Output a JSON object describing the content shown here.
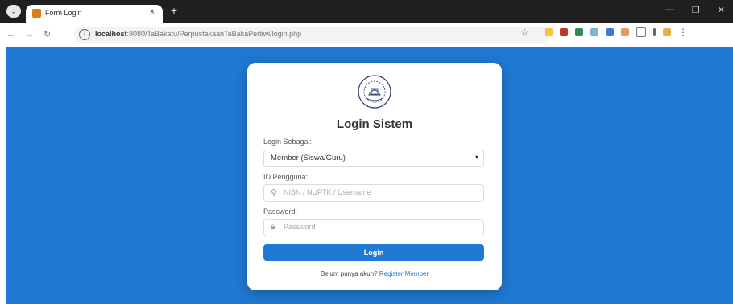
{
  "browser": {
    "tab_title": "Form Login",
    "tab_close": "×",
    "new_tab": "+",
    "url_host": "localhost",
    "url_rest": ":8080/TaBakatu/PerpustakaanTaBakaPertiwi/login.php"
  },
  "login": {
    "title": "Login Sistem",
    "role_label": "Login Sebagai:",
    "role_value": "Member (Siswa/Guru)",
    "id_label": "ID Pengguna:",
    "id_placeholder": "NISN / NUPTK / Username",
    "password_label": "Password:",
    "password_placeholder": "Password",
    "submit_label": "Login",
    "register_prompt": "Belum punya akun?",
    "register_link": "Register Member"
  },
  "colors": {
    "page_bg": "#1f78d1",
    "button": "#1f78d1",
    "link": "#1f78d1"
  },
  "icons": {
    "menu": "chevron-down-icon",
    "back": "back-arrow-icon",
    "forward": "forward-arrow-icon",
    "reload": "reload-icon",
    "site_info": "info-icon",
    "bookmark": "star-icon",
    "id_field": "user-icon",
    "password_field": "lock-icon"
  }
}
